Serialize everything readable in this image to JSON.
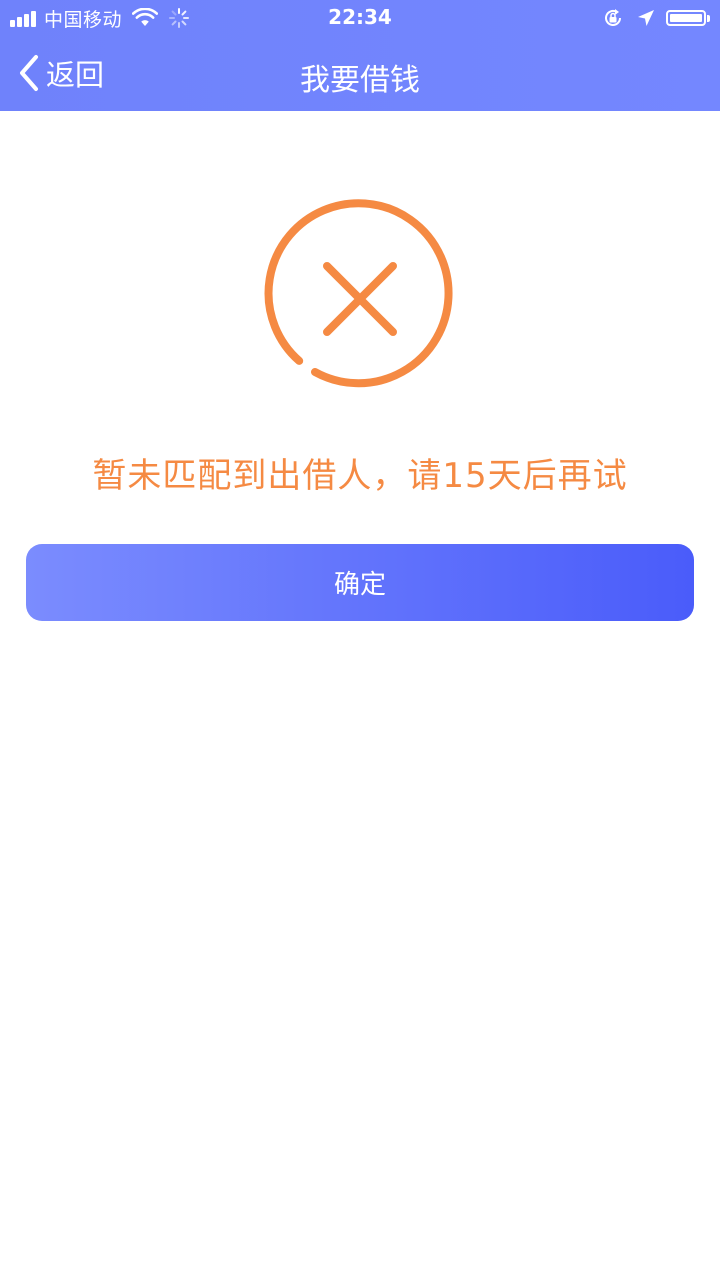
{
  "status_bar": {
    "carrier": "中国移动",
    "time": "22:34",
    "icons": [
      "signal-icon",
      "wifi-icon",
      "loading-spinner-icon",
      "rotation-lock-icon",
      "location-arrow-icon",
      "battery-icon"
    ]
  },
  "nav": {
    "back_label": "返回",
    "title": "我要借钱"
  },
  "result": {
    "icon": "error-x-circle-icon",
    "message": "暂未匹配到出借人，请15天后再试"
  },
  "actions": {
    "confirm_label": "确定"
  },
  "colors": {
    "header_start": "#6f82fb",
    "header_end": "#7487ff",
    "accent_orange": "#f58a43",
    "button_start": "#7b8cfe",
    "button_end": "#4a5cfa",
    "background": "#ffffff"
  }
}
